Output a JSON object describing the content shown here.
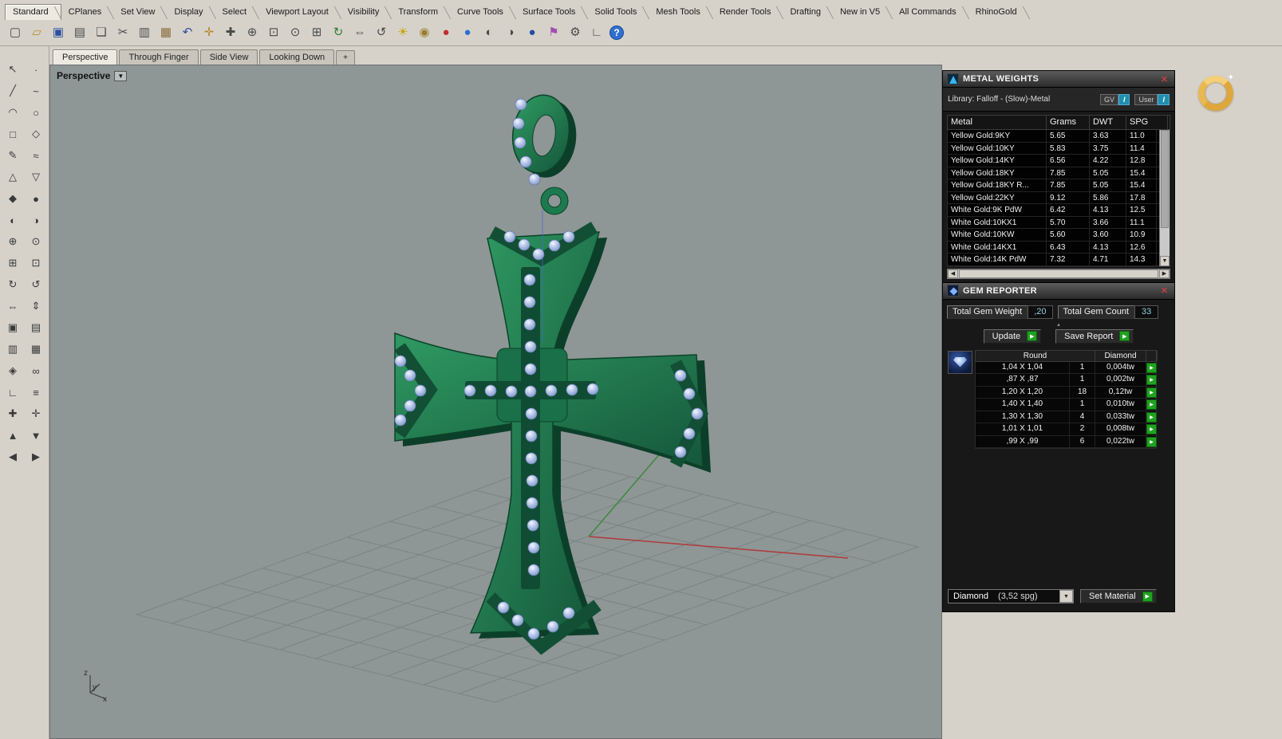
{
  "icons": {
    "close": "✕",
    "dropdown": "▼",
    "collapse": "▴",
    "scroll_left": "◀",
    "scroll_right": "▶",
    "scroll_down": "▼",
    "play": "▶",
    "viewport_dropdown": "▼"
  },
  "menu_bar": {
    "items": [
      "Standard",
      "CPlanes",
      "Set View",
      "Display",
      "Select",
      "Viewport Layout",
      "Visibility",
      "Transform",
      "Curve Tools",
      "Surface Tools",
      "Solid Tools",
      "Mesh Tools",
      "Render Tools",
      "Drafting",
      "New in V5",
      "All Commands",
      "RhinoGold"
    ]
  },
  "toolbar": {
    "icons": [
      {
        "name": "new-document-icon",
        "glyph": "▢",
        "color": "#4a4a4a"
      },
      {
        "name": "open-file-icon",
        "glyph": "▱",
        "color": "#b8922e"
      },
      {
        "name": "save-icon",
        "glyph": "▣",
        "color": "#2f4f9e"
      },
      {
        "name": "print-icon",
        "glyph": "▤",
        "color": "#4a4a4a"
      },
      {
        "name": "copy-to-clipboard-icon",
        "glyph": "❏",
        "color": "#4a4a4a"
      },
      {
        "name": "cut-icon",
        "glyph": "✂",
        "color": "#4a4a4a"
      },
      {
        "name": "copy-icon",
        "glyph": "▥",
        "color": "#4a4a4a"
      },
      {
        "name": "paste-icon",
        "glyph": "▦",
        "color": "#8a6d3b"
      },
      {
        "name": "undo-icon",
        "glyph": "↶",
        "color": "#2f4f9e"
      },
      {
        "name": "pan-hand-icon",
        "glyph": "✛",
        "color": "#b8862e"
      },
      {
        "name": "move-icon",
        "glyph": "✚",
        "color": "#4a4a4a"
      },
      {
        "name": "zoom-dynamic-icon",
        "glyph": "⊕",
        "color": "#4a4a4a"
      },
      {
        "name": "zoom-window-icon",
        "glyph": "⊡",
        "color": "#4a4a4a"
      },
      {
        "name": "zoom-selected-icon",
        "glyph": "⊙",
        "color": "#4a4a4a"
      },
      {
        "name": "zoom-extents-icon",
        "glyph": "⊞",
        "color": "#4a4a4a"
      },
      {
        "name": "rotate-view-icon",
        "glyph": "↻",
        "color": "#2e7d32"
      },
      {
        "name": "pan-view-icon",
        "glyph": "⇔",
        "color": "#4a4a4a"
      },
      {
        "name": "undo-view-icon",
        "glyph": "↺",
        "color": "#4a4a4a"
      },
      {
        "name": "light-bulb-icon",
        "glyph": "☀",
        "color": "#c9a400"
      },
      {
        "name": "lock-icon",
        "glyph": "◉",
        "color": "#9a7d2e"
      },
      {
        "name": "render-icon",
        "glyph": "●",
        "color": "#c03030"
      },
      {
        "name": "render-sphere-icon",
        "glyph": "●",
        "color": "#2f6fd0"
      },
      {
        "name": "shaded-viewport-icon",
        "glyph": "◐",
        "color": "#4a4a4a"
      },
      {
        "name": "ghosted-viewport-icon",
        "glyph": "◑",
        "color": "#4a4a4a"
      },
      {
        "name": "rendered-viewport-icon",
        "glyph": "●",
        "color": "#1f4fa0"
      },
      {
        "name": "flag-icon",
        "glyph": "⚑",
        "color": "#a050b0"
      },
      {
        "name": "options-gear-icon",
        "glyph": "⚙",
        "color": "#4a4a4a"
      },
      {
        "name": "cplane-icon",
        "glyph": "∟",
        "color": "#4a4a4a"
      },
      {
        "name": "help-icon",
        "glyph": "?",
        "color": "#ffffff"
      }
    ]
  },
  "left_toolbar": {
    "tools": [
      {
        "name": "select-tool-icon",
        "glyph": "↖"
      },
      {
        "name": "point-tool-icon",
        "glyph": "∙"
      },
      {
        "name": "line-tool-icon",
        "glyph": "╱"
      },
      {
        "name": "curve-tool-icon",
        "glyph": "~"
      },
      {
        "name": "arc-tool-icon",
        "glyph": "◠"
      },
      {
        "name": "circle-tool-icon",
        "glyph": "○"
      },
      {
        "name": "rectangle-tool-icon",
        "glyph": "□"
      },
      {
        "name": "polygon-tool-icon",
        "glyph": "◇"
      },
      {
        "name": "sketch-tool-icon",
        "glyph": "✎"
      },
      {
        "name": "surface-tool-icon",
        "glyph": "≈"
      },
      {
        "name": "plane-tool-icon",
        "glyph": "△"
      },
      {
        "name": "loft-tool-icon",
        "glyph": "▽"
      },
      {
        "name": "solid-tool-icon",
        "glyph": "◆"
      },
      {
        "name": "sphere-tool-icon",
        "glyph": "●"
      },
      {
        "name": "shaded-tool-icon",
        "glyph": "◐"
      },
      {
        "name": "ghosted-tool-icon",
        "glyph": "◑"
      },
      {
        "name": "boolean-union-tool-icon",
        "glyph": "⊕"
      },
      {
        "name": "boolean-intersect-tool-icon",
        "glyph": "⊙"
      },
      {
        "name": "split-tool-icon",
        "glyph": "⊞"
      },
      {
        "name": "trim-tool-icon",
        "glyph": "⊡"
      },
      {
        "name": "rotate-tool-icon",
        "glyph": "↻"
      },
      {
        "name": "rotate-3d-tool-icon",
        "glyph": "↺"
      },
      {
        "name": "mirror-tool-icon",
        "glyph": "⇔"
      },
      {
        "name": "flip-tool-icon",
        "glyph": "⇕"
      },
      {
        "name": "block-tool-icon",
        "glyph": "▣"
      },
      {
        "name": "hatch-tool-icon",
        "glyph": "▤"
      },
      {
        "name": "layer-tool-icon",
        "glyph": "▥"
      },
      {
        "name": "grid-tool-icon",
        "glyph": "▦"
      },
      {
        "name": "gem-tool-icon",
        "glyph": "◈"
      },
      {
        "name": "torus-tool-icon",
        "glyph": "∞"
      },
      {
        "name": "cplane-tool-icon",
        "glyph": "∟"
      },
      {
        "name": "layers-tool-icon",
        "glyph": "≡"
      },
      {
        "name": "array-tool-icon",
        "glyph": "✚"
      },
      {
        "name": "orient-tool-icon",
        "glyph": "✛"
      },
      {
        "name": "extrude-up-tool-icon",
        "glyph": "▲"
      },
      {
        "name": "extrude-down-tool-icon",
        "glyph": "▼"
      },
      {
        "name": "offset-left-tool-icon",
        "glyph": "◀"
      },
      {
        "name": "offset-right-tool-icon",
        "glyph": "▶"
      }
    ]
  },
  "viewport_tabs": {
    "tabs": [
      "Perspective",
      "Through Finger",
      "Side View",
      "Looking Down"
    ],
    "add_label": "+"
  },
  "viewport": {
    "label": "Perspective",
    "axis": {
      "x": "x",
      "y": "y",
      "z": "z"
    }
  },
  "metal_weights": {
    "title": "METAL WEIGHTS",
    "library_label": "Library: Falloff - (Slow)-Metal",
    "gv_label": "GV",
    "gv_state": "I",
    "user_label": "User",
    "user_state": "I",
    "columns": [
      "Metal",
      "Grams",
      "DWT",
      "SPG"
    ],
    "rows": [
      {
        "metal": "Yellow Gold:9KY",
        "grams": "5.65",
        "dwt": "3.63",
        "spg": "11.0"
      },
      {
        "metal": "Yellow Gold:10KY",
        "grams": "5.83",
        "dwt": "3.75",
        "spg": "11.4"
      },
      {
        "metal": "Yellow Gold:14KY",
        "grams": "6.56",
        "dwt": "4.22",
        "spg": "12.8"
      },
      {
        "metal": "Yellow Gold:18KY",
        "grams": "7.85",
        "dwt": "5.05",
        "spg": "15.4"
      },
      {
        "metal": "Yellow Gold:18KY R...",
        "grams": "7.85",
        "dwt": "5.05",
        "spg": "15.4"
      },
      {
        "metal": "Yellow Gold:22KY",
        "grams": "9.12",
        "dwt": "5.86",
        "spg": "17.8"
      },
      {
        "metal": "White Gold:9K PdW",
        "grams": "6.42",
        "dwt": "4.13",
        "spg": "12.5"
      },
      {
        "metal": "White Gold:10KX1",
        "grams": "5.70",
        "dwt": "3.66",
        "spg": "11.1"
      },
      {
        "metal": "White Gold:10KW",
        "grams": "5.60",
        "dwt": "3.60",
        "spg": "10.9"
      },
      {
        "metal": "White Gold:14KX1",
        "grams": "6.43",
        "dwt": "4.13",
        "spg": "12.6"
      },
      {
        "metal": "White Gold:14K PdW",
        "grams": "7.32",
        "dwt": "4.71",
        "spg": "14.3"
      }
    ]
  },
  "gem_reporter": {
    "title": "GEM REPORTER",
    "total_weight_label": "Total Gem Weight",
    "total_weight_value": ",20",
    "total_count_label": "Total Gem Count",
    "total_count_value": "33",
    "update_label": "Update",
    "save_report_label": "Save Report",
    "table": {
      "shape_header": "Round",
      "material_header": "Diamond",
      "rows": [
        {
          "size": "1,04 X 1,04",
          "count": "1",
          "weight": "0,004tw"
        },
        {
          "size": ",87 X ,87",
          "count": "1",
          "weight": "0,002tw"
        },
        {
          "size": "1,20 X 1,20",
          "count": "18",
          "weight": "0,12tw"
        },
        {
          "size": "1,40 X 1,40",
          "count": "1",
          "weight": "0,010tw"
        },
        {
          "size": "1,30 X 1,30",
          "count": "4",
          "weight": "0,033tw"
        },
        {
          "size": "1,01 X 1,01",
          "count": "2",
          "weight": "0,008tw"
        },
        {
          "size": ",99 X ,99",
          "count": "6",
          "weight": "0,022tw"
        }
      ]
    },
    "material_name": "Diamond",
    "material_spg": "(3,52 spg)",
    "set_material_label": "Set Material"
  },
  "colors": {
    "accent_green": "#21a121",
    "panel_bg": "#181818",
    "value_teal": "#8fd0e0",
    "viewport_bg": "#8f9696",
    "cross_green": "#1e7a4b",
    "gem_blue": "#aebfe6",
    "gold": "#dfa63a"
  }
}
